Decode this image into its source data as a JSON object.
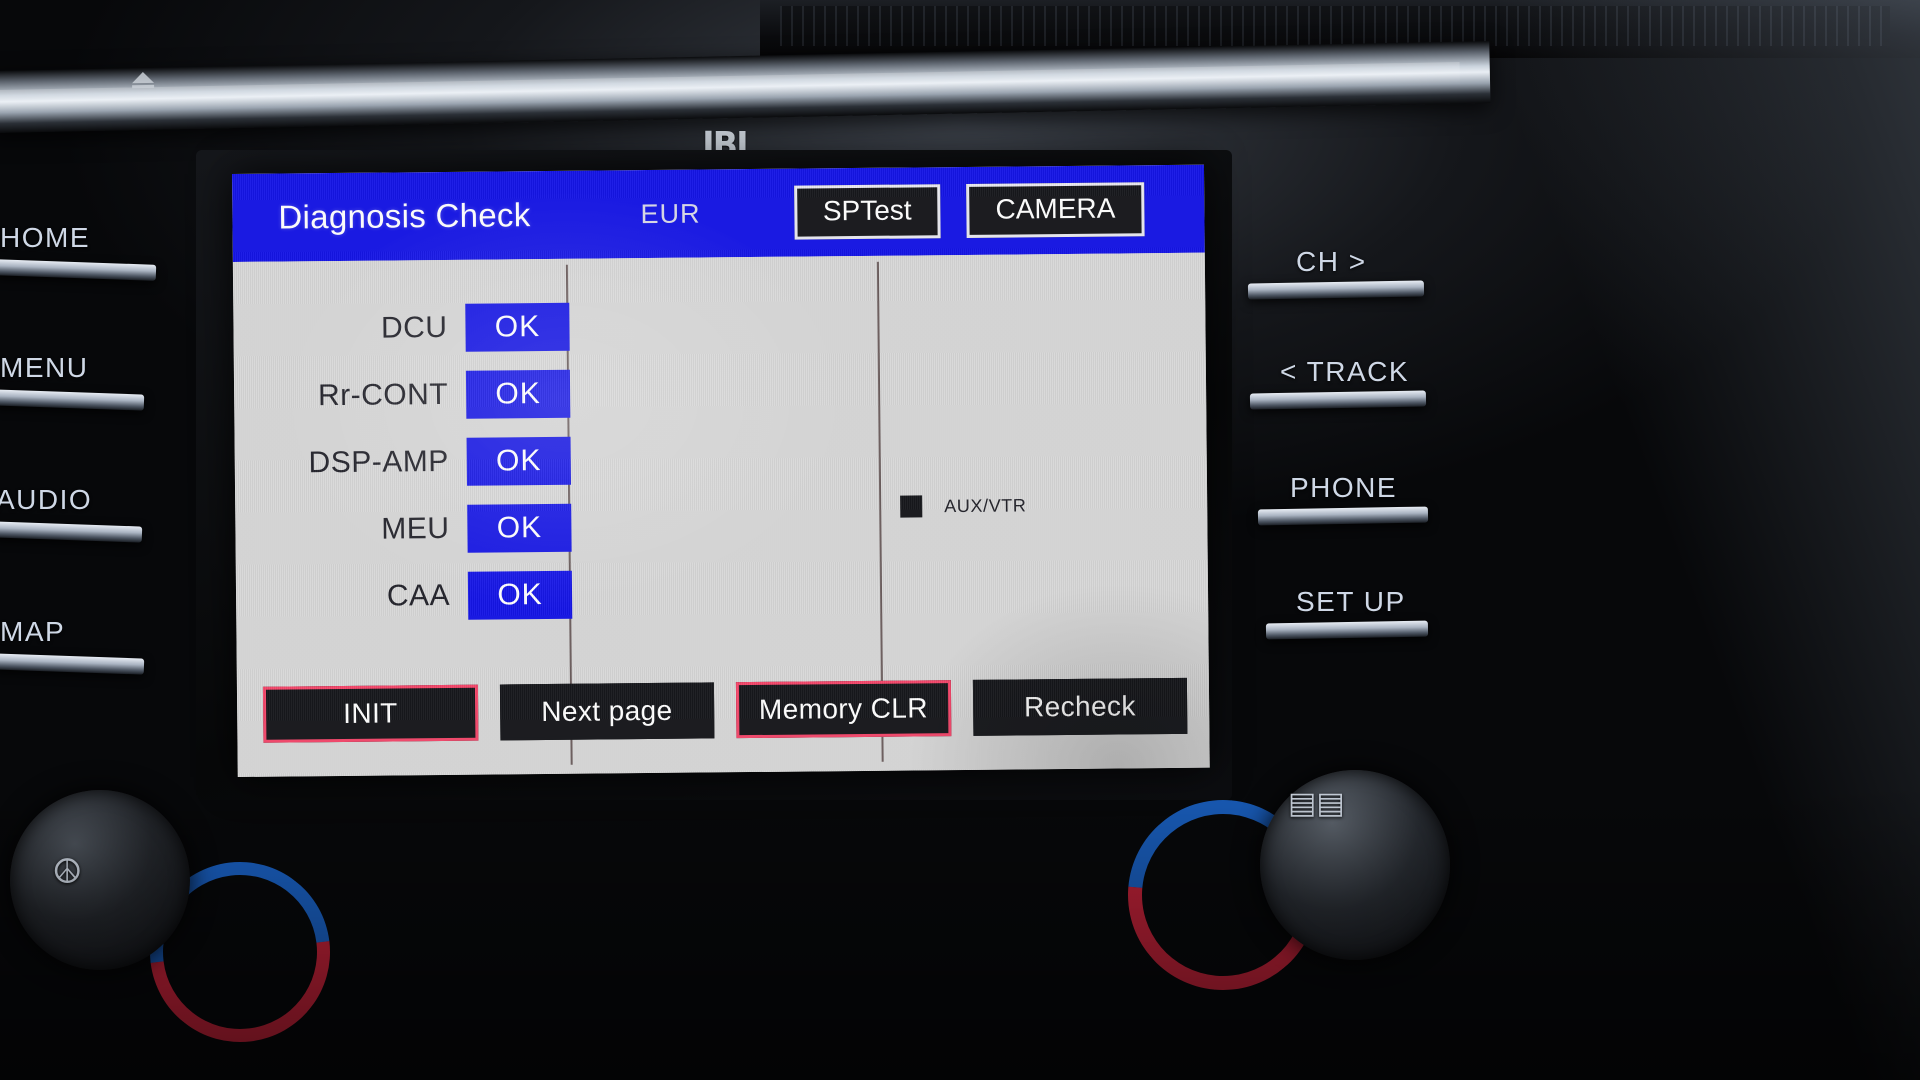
{
  "device": {
    "brand_badge": "JBL"
  },
  "header": {
    "title": "Diagnosis Check",
    "region": "EUR",
    "buttons": [
      {
        "label": "SPTest",
        "name": "sptest-button"
      },
      {
        "label": "CAMERA",
        "name": "camera-button"
      }
    ],
    "bg_color": "#1515e6",
    "text_color": "#ffffff"
  },
  "main": {
    "status_items": [
      {
        "label": "DCU",
        "status": "OK"
      },
      {
        "label": "Rr-CONT",
        "status": "OK"
      },
      {
        "label": "DSP-AMP",
        "status": "OK"
      },
      {
        "label": "MEU",
        "status": "OK"
      },
      {
        "label": "CAA",
        "status": "OK"
      }
    ],
    "status_badge_color": "#1515e6",
    "aux": {
      "label": "AUX/VTR",
      "checked": true
    }
  },
  "actions": [
    {
      "label": "INIT",
      "highlighted": true,
      "name": "init-button"
    },
    {
      "label": "Next page",
      "highlighted": false,
      "name": "next-page-button"
    },
    {
      "label": "Memory CLR",
      "highlighted": true,
      "name": "memory-clr-button"
    },
    {
      "label": "Recheck",
      "highlighted": false,
      "name": "recheck-button"
    }
  ],
  "hard_keys": {
    "left": [
      "HOME",
      "MENU",
      "AUDIO",
      "MAP"
    ],
    "right": [
      "CH >",
      "< TRACK",
      "PHONE",
      "SET UP"
    ]
  },
  "colors": {
    "accent_blue": "#1515e6",
    "highlight_red": "#f4476b",
    "screen_bg": "#d7d7d7",
    "button_black": "#17181c"
  }
}
